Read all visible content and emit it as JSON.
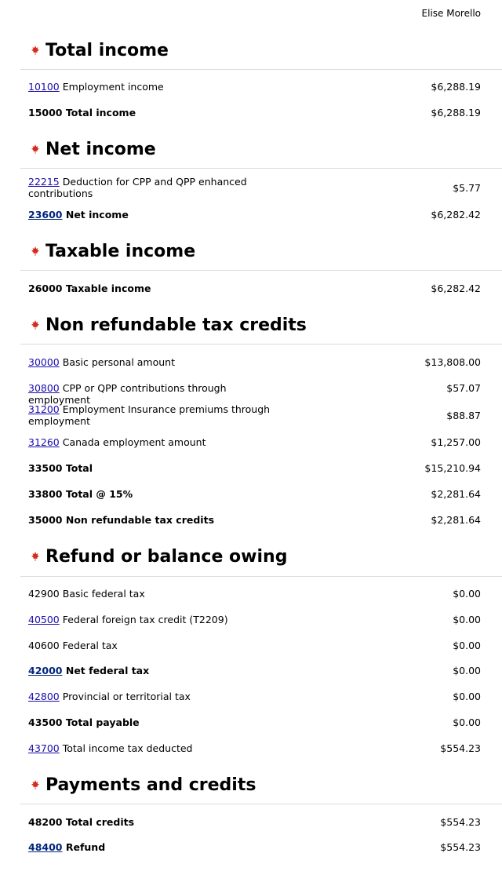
{
  "header": {
    "user_name": "Elise Morello"
  },
  "sections": [
    {
      "title": "Total income",
      "rows": [
        {
          "code": "10100",
          "code_link": true,
          "label": "Employment income",
          "amount": "$6,288.19",
          "bold": false
        },
        {
          "code": "15000",
          "code_link": false,
          "label": "Total income",
          "amount": "$6,288.19",
          "bold": true
        }
      ]
    },
    {
      "title": "Net income",
      "rows": [
        {
          "code": "22215",
          "code_link": true,
          "label": "Deduction for CPP and QPP enhanced contributions",
          "amount": "$5.77",
          "bold": false
        },
        {
          "code": "23600",
          "code_link": true,
          "label": "Net income",
          "amount": "$6,282.42",
          "bold": true
        }
      ]
    },
    {
      "title": "Taxable income",
      "rows": [
        {
          "code": "26000",
          "code_link": false,
          "label": "Taxable income",
          "amount": "$6,282.42",
          "bold": true
        }
      ]
    },
    {
      "title": "Non refundable tax credits",
      "rows": [
        {
          "code": "30000",
          "code_link": true,
          "label": "Basic personal amount",
          "amount": "$13,808.00",
          "bold": false
        },
        {
          "code": "30800",
          "code_link": true,
          "label": "CPP or QPP contributions through employment",
          "amount": "$57.07",
          "bold": false
        },
        {
          "code": "31200",
          "code_link": true,
          "label": "Employment Insurance premiums through employment",
          "amount": "$88.87",
          "bold": false
        },
        {
          "code": "31260",
          "code_link": true,
          "label": "Canada employment amount",
          "amount": "$1,257.00",
          "bold": false
        },
        {
          "code": "33500",
          "code_link": false,
          "label": "Total",
          "amount": "$15,210.94",
          "bold": true
        },
        {
          "code": "33800",
          "code_link": false,
          "label": "Total @ 15%",
          "amount": "$2,281.64",
          "bold": true
        },
        {
          "code": "35000",
          "code_link": false,
          "label": "Non refundable tax credits",
          "amount": "$2,281.64",
          "bold": true
        }
      ]
    },
    {
      "title": "Refund or balance owing",
      "rows": [
        {
          "code": "42900",
          "code_link": false,
          "label": "Basic federal tax",
          "amount": "$0.00",
          "bold": false
        },
        {
          "code": "40500",
          "code_link": true,
          "label": "Federal foreign tax credit (T2209)",
          "amount": "$0.00",
          "bold": false
        },
        {
          "code": "40600",
          "code_link": false,
          "label": "Federal tax",
          "amount": "$0.00",
          "bold": false
        },
        {
          "code": "42000",
          "code_link": true,
          "label": "Net federal tax",
          "amount": "$0.00",
          "bold": true
        },
        {
          "code": "42800",
          "code_link": true,
          "label": "Provincial or territorial tax",
          "amount": "$0.00",
          "bold": false
        },
        {
          "code": "43500",
          "code_link": false,
          "label": "Total payable",
          "amount": "$0.00",
          "bold": true
        },
        {
          "code": "43700",
          "code_link": true,
          "label": "Total income tax deducted",
          "amount": "$554.23",
          "bold": false
        }
      ]
    },
    {
      "title": "Payments and credits",
      "rows": [
        {
          "code": "48200",
          "code_link": false,
          "label": "Total credits",
          "amount": "$554.23",
          "bold": true
        },
        {
          "code": "48400",
          "code_link": true,
          "label": "Refund",
          "amount": "$554.23",
          "bold": true
        }
      ]
    }
  ],
  "icons": {
    "section_icon": "maple-leaf-icon"
  },
  "colors": {
    "link": "#1a0dab",
    "bold_link": "#00247d",
    "leaf": "#d52b1e",
    "rule": "#dcdcdc"
  }
}
